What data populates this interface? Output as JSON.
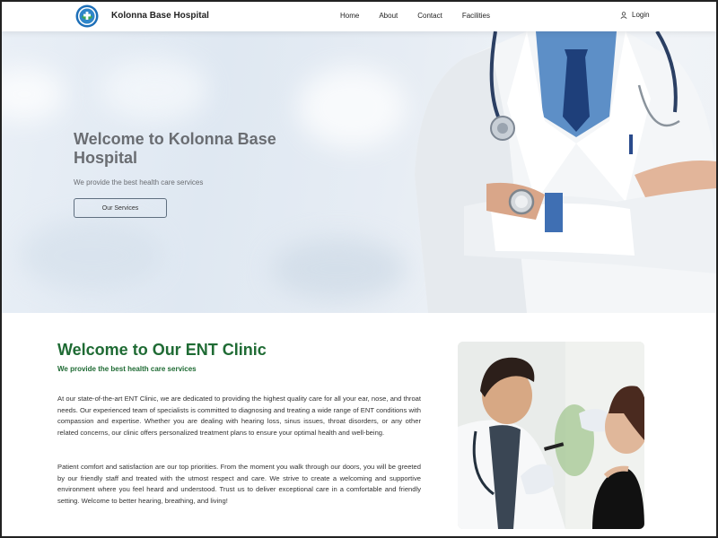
{
  "navbar": {
    "brand": "Kolonna Base Hospital",
    "links": [
      "Home",
      "About",
      "Contact",
      "Facilities"
    ],
    "login": "Login"
  },
  "hero": {
    "title": "Welcome to Kolonna Base Hospital",
    "subtitle": "We provide the best health care services",
    "button": "Our Services"
  },
  "ent": {
    "title": "Welcome to Our ENT Clinic",
    "subtitle": "We provide the best health care services",
    "paragraph1": "At our state-of-the-art ENT Clinic, we are dedicated to providing the highest quality care for all your ear, nose, and throat needs. Our experienced team of specialists is committed to diagnosing and treating a wide range of ENT conditions with compassion and expertise. Whether you are dealing with hearing loss, sinus issues, throat disorders, or any other related concerns, our clinic offers personalized treatment plans to ensure your optimal health and well-being.",
    "paragraph2": "Patient comfort and satisfaction are our top priorities. From the moment you walk through our doors, you will be greeted by our friendly staff and treated with the utmost respect and care. We strive to create a welcoming and supportive environment where you feel heard and understood. Trust us to deliver exceptional care in a comfortable and friendly setting. Welcome to better hearing, breathing, and living!"
  },
  "colors": {
    "accent_green": "#1f6b34",
    "hero_text": "#6a6d72",
    "logo_blue": "#1d6fb8",
    "logo_green": "#3aa655"
  }
}
